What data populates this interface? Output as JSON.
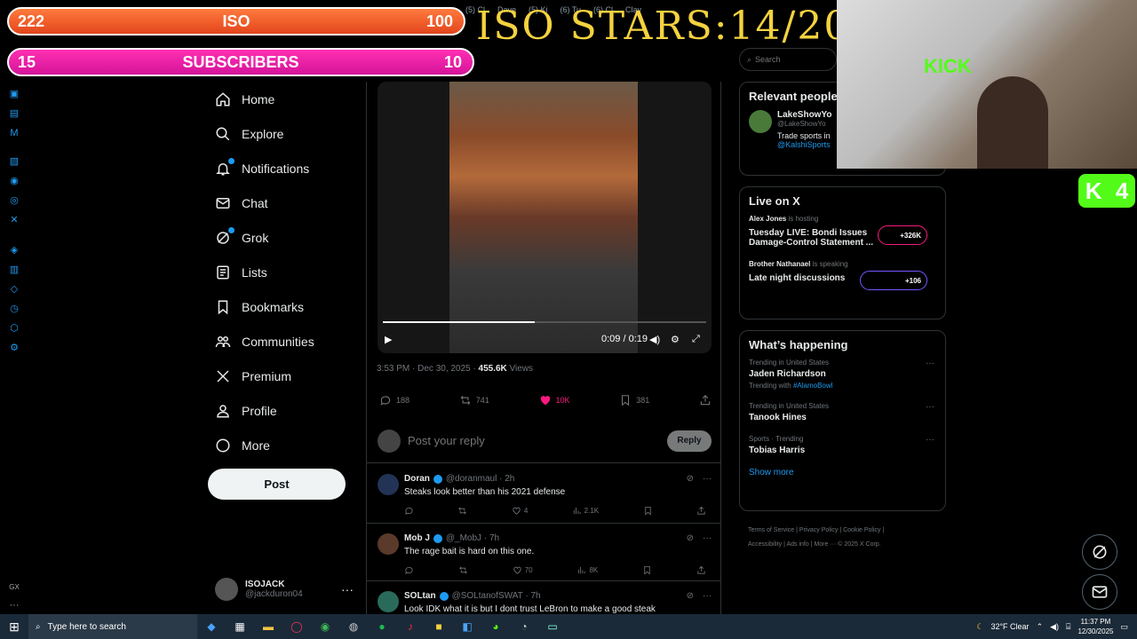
{
  "overlay": {
    "iso_left": "222",
    "iso_label": "ISO",
    "iso_right": "100",
    "sub_left": "15",
    "sub_label": "SUBSCRIBERS",
    "sub_right": "10",
    "iso_stars": "ISO STARS:14/20",
    "kick_badge": "4",
    "webcam_sign": "KICK"
  },
  "tabs": [
    "(5) Cl",
    "Dave",
    "(5) Ki",
    "(6) Tu",
    "(6) Cl",
    "Clav"
  ],
  "nav": {
    "items": [
      {
        "label": "Home",
        "icon": "home-icon"
      },
      {
        "label": "Explore",
        "icon": "search-icon"
      },
      {
        "label": "Notifications",
        "icon": "bell-icon"
      },
      {
        "label": "Chat",
        "icon": "mail-icon"
      },
      {
        "label": "Grok",
        "icon": "grok-icon"
      },
      {
        "label": "Lists",
        "icon": "list-icon"
      },
      {
        "label": "Bookmarks",
        "icon": "bookmark-icon"
      },
      {
        "label": "Communities",
        "icon": "people-icon"
      },
      {
        "label": "Premium",
        "icon": "x-icon"
      },
      {
        "label": "Profile",
        "icon": "person-icon"
      },
      {
        "label": "More",
        "icon": "more-circle-icon"
      }
    ],
    "post_label": "Post",
    "account_name": "ISOJACK",
    "account_handle": "@jackduron04"
  },
  "video": {
    "time": "0:09 / 0:19",
    "progress": 0.47
  },
  "tweet": {
    "timestamp": "3:53 PM · Dec 30, 2025 · ",
    "views": "455.6K",
    "views_label": " Views",
    "replies": "188",
    "reposts": "741",
    "likes": "10K",
    "bookmarks": "381"
  },
  "reply_box": {
    "placeholder": "Post your reply",
    "button": "Reply"
  },
  "replies": [
    {
      "name": "Doran",
      "handle": "@doranmaul · 2h",
      "text": "Steaks look better than his 2021 defense",
      "likes": "4",
      "views": "2.1K",
      "avatar_color": "#223355"
    },
    {
      "name": "Mob J",
      "handle": "@_MobJ · 7h",
      "text": "The rage bait is hard on this one.",
      "likes": "70",
      "views": "8K",
      "avatar_color": "#5a3a2a"
    },
    {
      "name": "SOLtan",
      "handle": "@SOLtanofSWAT · 7h",
      "text": "Look IDK what it is but I dont trust LeBron to make a good steak",
      "likes": "",
      "views": "",
      "avatar_color": "#2a6a5a"
    }
  ],
  "search": {
    "placeholder": "Search"
  },
  "relevant": {
    "title": "Relevant people",
    "name": "LakeShowYo",
    "handle": "@LakeShowYo",
    "bio": "Trade sports in",
    "link": "@KalshiSports"
  },
  "live": {
    "title": "Live on X",
    "item1_host": "Alex Jones",
    "item1_status": "is hosting",
    "item1_title": "Tuesday LIVE: Bondi Issues Damage-Control Statement ...",
    "item1_count": "+326K",
    "item2_host": "Brother Nathanael",
    "item2_status": "is speaking",
    "item2_title": "Late night discussions",
    "item2_count": "+106"
  },
  "happening": {
    "title": "What’s happening",
    "trends": [
      {
        "context": "Trending in United States",
        "name": "Jaden Richardson",
        "extra_prefix": "Trending with ",
        "extra_tag": "#AlamoBowl"
      },
      {
        "context": "Trending in United States",
        "name": "Tanook Hines",
        "extra_prefix": "",
        "extra_tag": ""
      },
      {
        "context": "Sports · Trending",
        "name": "Tobias Harris",
        "extra_prefix": "",
        "extra_tag": ""
      }
    ],
    "show_more": "Show more"
  },
  "footer": {
    "line1": "Terms of Service  |  Privacy Policy  |  Cookie Policy  |",
    "line2": "Accessibility  |  Ads info  |  More ···   © 2025 X Corp."
  },
  "taskbar": {
    "search_placeholder": "Type here to search",
    "weather": "32°F  Clear",
    "time": "11:37 PM",
    "date": "12/30/2025"
  },
  "colors": {
    "accent": "#1d9bf0",
    "like": "#f91880",
    "iso_bar": "#e2461c",
    "sub_bar": "#d4149a",
    "stars": "#f4d23e",
    "kick": "#53fc18"
  }
}
